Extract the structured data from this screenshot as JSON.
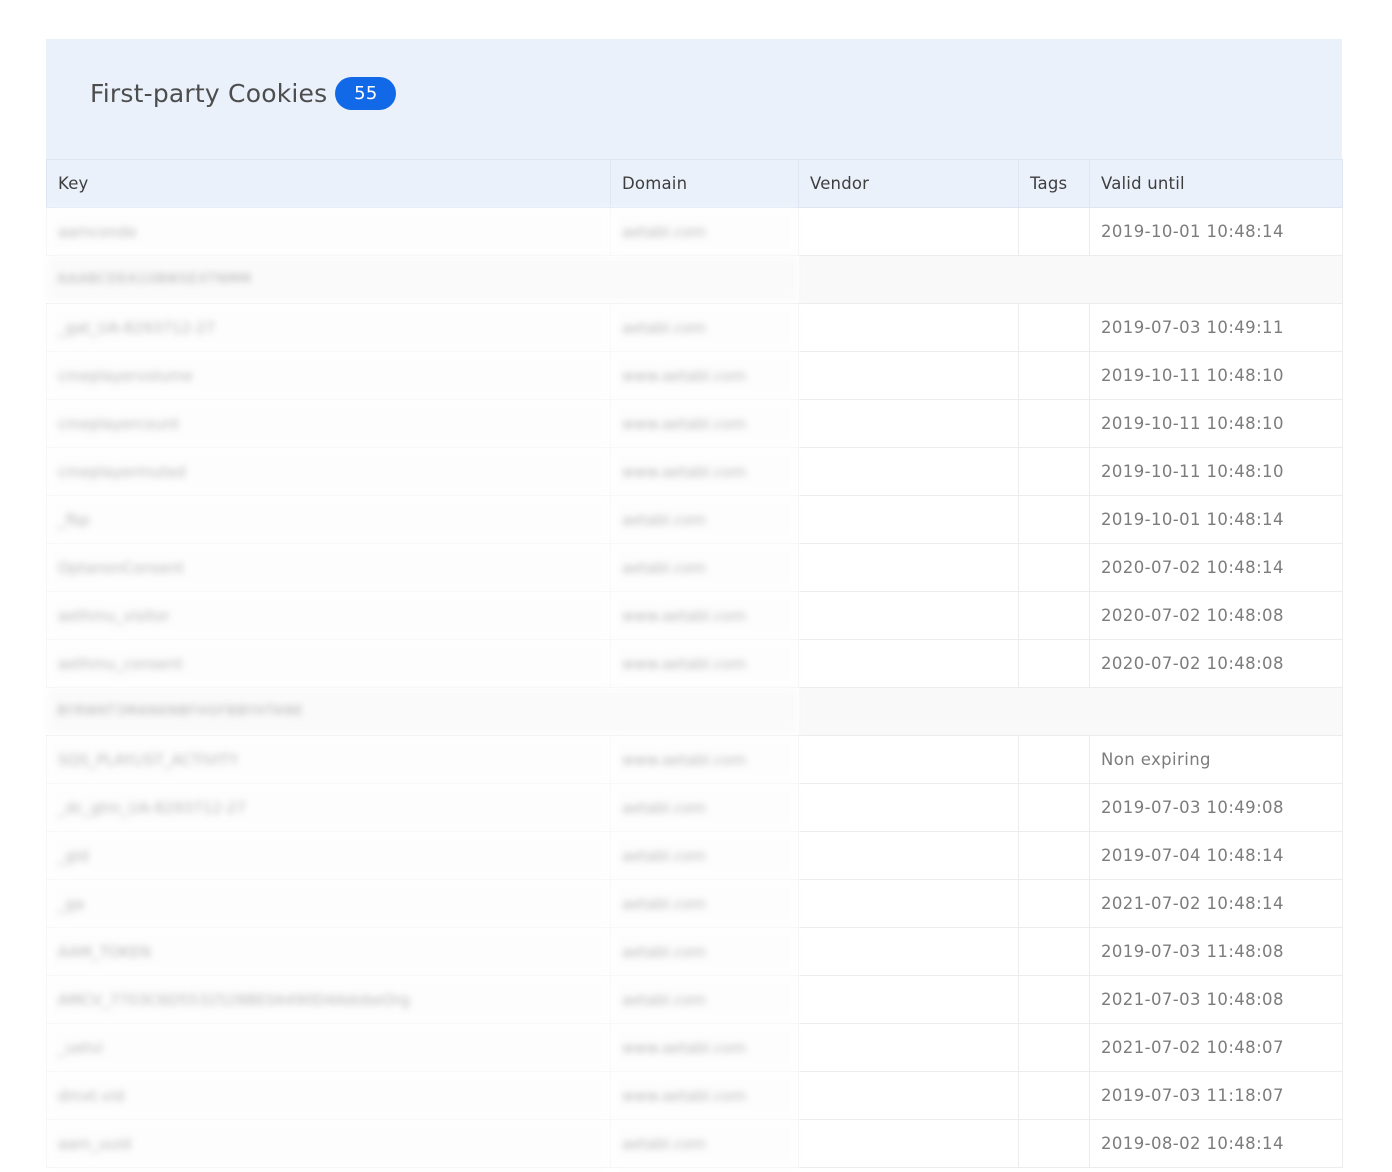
{
  "panel": {
    "title": "First-party Cookies",
    "count": "55"
  },
  "table": {
    "columns": [
      "Key",
      "Domain",
      "Vendor",
      "Tags",
      "Valid until"
    ],
    "rows": [
      {
        "type": "cookie",
        "key": "aamconde",
        "domain": "aetabl.com",
        "vendor": "",
        "tags": "",
        "valid_until": "2019-10-01 10:48:14"
      },
      {
        "type": "group",
        "label": "AAABCDEA10BWSEXTNMM"
      },
      {
        "type": "cookie",
        "key": "_gat_UA-8293712-27",
        "domain": "aetabl.com",
        "vendor": "",
        "tags": "",
        "valid_until": "2019-07-03 10:49:11"
      },
      {
        "type": "cookie",
        "key": "cmeplayervolume",
        "domain": "www.aetabl.com",
        "vendor": "",
        "tags": "",
        "valid_until": "2019-10-11 10:48:10"
      },
      {
        "type": "cookie",
        "key": "cmeplayercount",
        "domain": "www.aetabl.com",
        "vendor": "",
        "tags": "",
        "valid_until": "2019-10-11 10:48:10"
      },
      {
        "type": "cookie",
        "key": "cmeplayermuted",
        "domain": "www.aetabl.com",
        "vendor": "",
        "tags": "",
        "valid_until": "2019-10-11 10:48:10"
      },
      {
        "type": "cookie",
        "key": "_fbp",
        "domain": "aetabl.com",
        "vendor": "",
        "tags": "",
        "valid_until": "2019-10-01 10:48:14"
      },
      {
        "type": "cookie",
        "key": "OptanonConsent",
        "domain": "aetabl.com",
        "vendor": "",
        "tags": "",
        "valid_until": "2020-07-02 10:48:14"
      },
      {
        "type": "cookie",
        "key": "aethmu_visitor",
        "domain": "www.aetabl.com",
        "vendor": "",
        "tags": "",
        "valid_until": "2020-07-02 10:48:08"
      },
      {
        "type": "cookie",
        "key": "aethmu_consent",
        "domain": "www.aetabl.com",
        "vendor": "",
        "tags": "",
        "valid_until": "2020-07-02 10:48:08"
      },
      {
        "type": "group",
        "label": "BYRWKT3MAN6NBFHGFBBYHTANE"
      },
      {
        "type": "cookie",
        "key": "SQS_PLAYLIST_ACTIVITY",
        "domain": "www.aetabl.com",
        "vendor": "",
        "tags": "",
        "valid_until": "Non expiring"
      },
      {
        "type": "cookie",
        "key": "_dc_gtm_UA-8293712-27",
        "domain": "aetabl.com",
        "vendor": "",
        "tags": "",
        "valid_until": "2019-07-03 10:49:08"
      },
      {
        "type": "cookie",
        "key": "_gid",
        "domain": "aetabl.com",
        "vendor": "",
        "tags": "",
        "valid_until": "2019-07-04 10:48:14"
      },
      {
        "type": "cookie",
        "key": "_ga",
        "domain": "aetabl.com",
        "vendor": "",
        "tags": "",
        "valid_until": "2021-07-02 10:48:14"
      },
      {
        "type": "cookie",
        "key": "AAM_TOKEN",
        "domain": "aetabl.com",
        "vendor": "",
        "tags": "",
        "valid_until": "2019-07-03 11:48:08"
      },
      {
        "type": "cookie",
        "key": "AMCV_7703C6D5532528BE0A490D4AdobeOrg",
        "domain": "aetabl.com",
        "vendor": "",
        "tags": "",
        "valid_until": "2021-07-03 10:48:08"
      },
      {
        "type": "cookie",
        "key": "_uetvi",
        "domain": "www.aetabl.com",
        "vendor": "",
        "tags": "",
        "valid_until": "2021-07-02 10:48:07"
      },
      {
        "type": "cookie",
        "key": "dmxt.vid",
        "domain": "www.aetabl.com",
        "vendor": "",
        "tags": "",
        "valid_until": "2019-07-03 11:18:07"
      },
      {
        "type": "cookie",
        "key": "aam_uuid",
        "domain": "aetabl.com",
        "vendor": "",
        "tags": "",
        "valid_until": "2019-08-02 10:48:14"
      }
    ]
  }
}
